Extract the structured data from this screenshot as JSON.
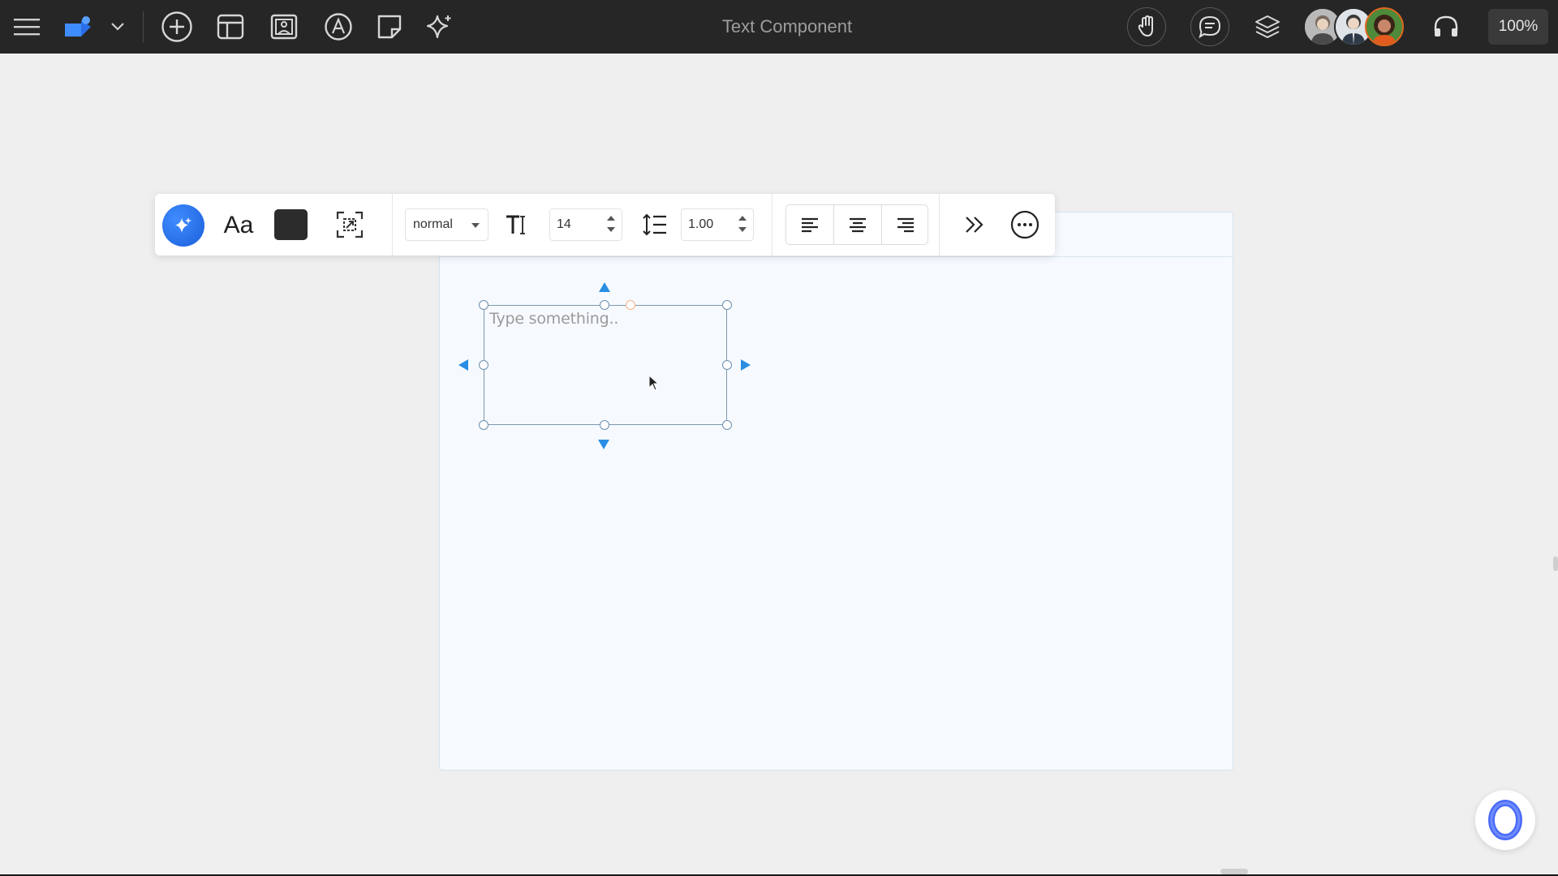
{
  "topbar": {
    "title": "Text Component",
    "zoom": "100%",
    "icons": [
      "menu-icon",
      "shapes-logo-icon",
      "chevron-down-icon",
      "add-circle-icon",
      "layout-icon",
      "image-icon",
      "pen-icon",
      "sticky-note-icon",
      "sparkle-icon",
      "hand-icon",
      "comment-icon",
      "layers-icon",
      "headphones-icon"
    ]
  },
  "toolbar": {
    "font_button_label": "Aa",
    "text_color": "#2c2c2c",
    "font_weight": "normal",
    "font_size": "14",
    "line_height": "1.00"
  },
  "text_component": {
    "placeholder": "Type something.."
  },
  "colors": {
    "topbar_bg": "#262626",
    "canvas_bg": "#efefef",
    "frame_bg": "#f6fafe",
    "accent": "#2a8de3",
    "ai_button": "#2a6ee8"
  }
}
